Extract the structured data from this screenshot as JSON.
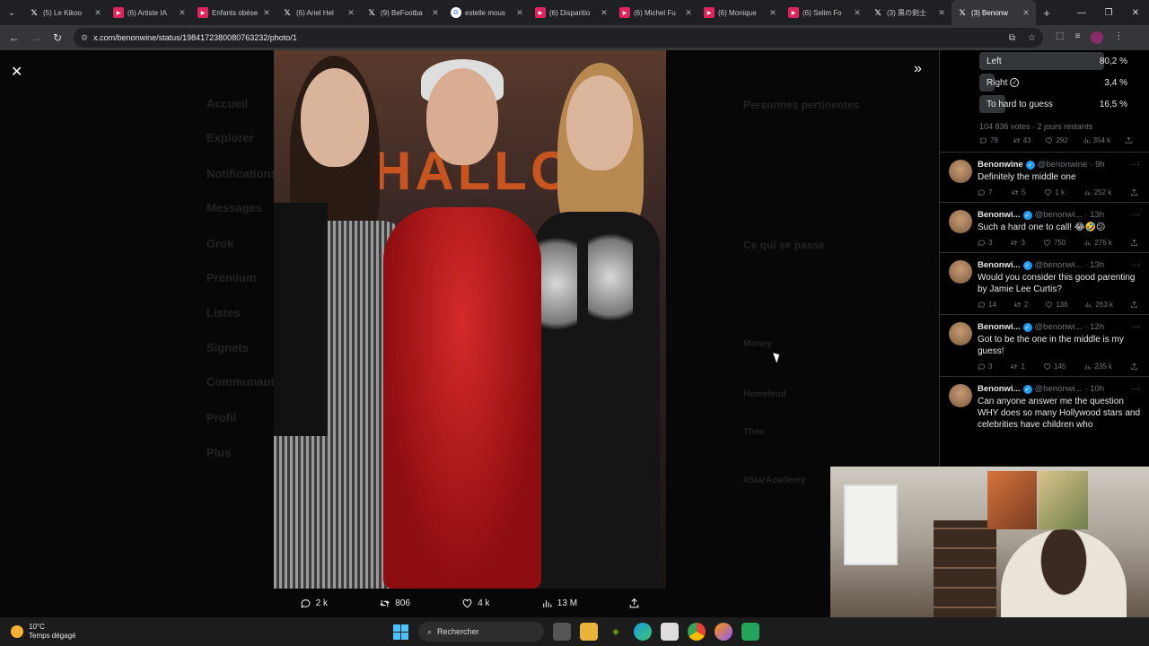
{
  "browser": {
    "tabs": [
      {
        "icon": "x",
        "title": "(5) Le Kikoo"
      },
      {
        "icon": "yt",
        "title": "(6) Artiste IA"
      },
      {
        "icon": "yt",
        "title": "Enfants obèse"
      },
      {
        "icon": "x",
        "title": "(6) Ariel Hel"
      },
      {
        "icon": "x",
        "title": "(9) BeFootba"
      },
      {
        "icon": "g",
        "title": "estelle mous"
      },
      {
        "icon": "yt",
        "title": "(6) Disparitio"
      },
      {
        "icon": "yt",
        "title": "(6) Michel Fu"
      },
      {
        "icon": "yt",
        "title": "(6) Monique"
      },
      {
        "icon": "yt",
        "title": "(6) Selim Fo"
      },
      {
        "icon": "x",
        "title": "(3) 黒の剣士"
      },
      {
        "icon": "x",
        "title": "(3) Benonw",
        "active": true
      }
    ],
    "url": "x.com/benonwine/status/1984172380080763232/photo/1"
  },
  "background": {
    "nav": [
      "Accueil",
      "Explorer",
      "Notifications",
      "Messages",
      "Grok",
      "Premium",
      "Listes",
      "Signets",
      "Communautés",
      "Profil",
      "Plus"
    ],
    "right_title": "Personnes pertinentes",
    "happening": "Ce qui se passe",
    "trends": [
      "Money",
      "Hemelend",
      "Theo",
      "#StarAcademy"
    ]
  },
  "photo": {
    "wall_text": "HALLOW"
  },
  "tweet_actions": {
    "replies": "2 k",
    "retweets": "806",
    "likes": "4 k",
    "views": "13 M"
  },
  "poll": {
    "options": [
      {
        "label": "Left",
        "pct": "80,2 %",
        "fill": 0.802,
        "icon": ""
      },
      {
        "label": "Right",
        "pct": "3,4 %",
        "fill": 0.034,
        "icon": "check-icon"
      },
      {
        "label": "To hard to guess",
        "pct": "16,5 %",
        "fill": 0.165,
        "icon": ""
      }
    ],
    "meta": "104 836 votes · 2 jours restants",
    "stats": {
      "replies": "78",
      "retweets": "43",
      "likes": "292",
      "views": "354 k"
    }
  },
  "replies": [
    {
      "name": "Benonwine",
      "handle": "@benonwine",
      "time": "· 9h",
      "text": "Definitely the middle one",
      "stats": {
        "replies": "7",
        "retweets": "5",
        "likes": "1 k",
        "views": "252 k"
      }
    },
    {
      "name": "Benonwi...",
      "handle": "@benonwi...",
      "time": "· 13h",
      "text": "Such a hard one to call! 😂🤣😕",
      "stats": {
        "replies": "3",
        "retweets": "3",
        "likes": "750",
        "views": "276 k"
      }
    },
    {
      "name": "Benonwi...",
      "handle": "@benonwi...",
      "time": "· 13h",
      "text": "Would you consider this good parenting by Jamie Lee Curtis?",
      "stats": {
        "replies": "14",
        "retweets": "2",
        "likes": "136",
        "views": "263 k"
      }
    },
    {
      "name": "Benonwi...",
      "handle": "@benonwi...",
      "time": "· 12h",
      "text": "Got to be the one in the middle is my guess!",
      "stats": {
        "replies": "3",
        "retweets": "1",
        "likes": "145",
        "views": "235 k"
      }
    },
    {
      "name": "Benonwi...",
      "handle": "@benonwi...",
      "time": "· 10h",
      "text": "Can anyone answer me the question WHY does so many Hollywood stars and celebrities have children who",
      "stats": {
        "replies": "",
        "retweets": "",
        "likes": "",
        "views": ""
      }
    }
  ],
  "taskbar": {
    "temp": "10°C",
    "weather": "Temps dégagé",
    "search": "Rechercher"
  }
}
